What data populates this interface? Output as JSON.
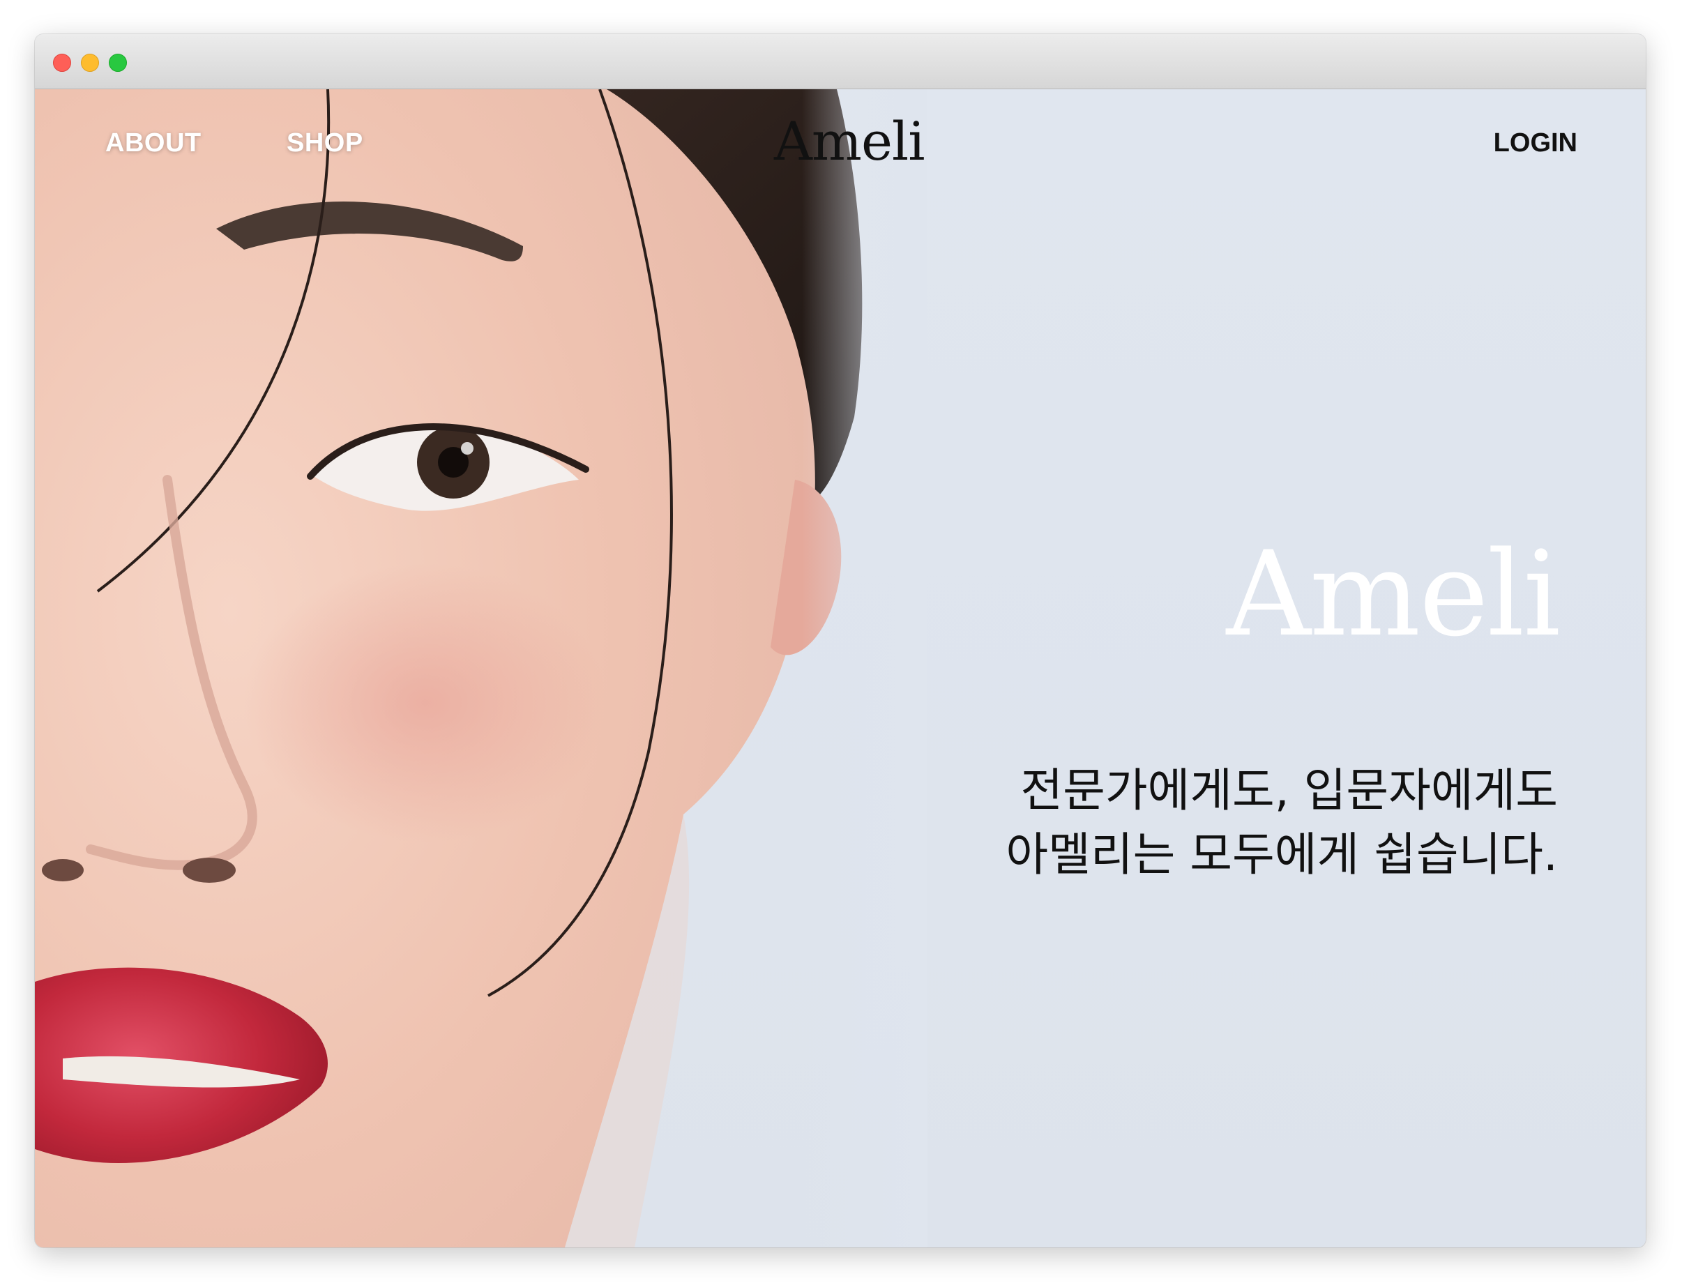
{
  "window": {
    "controls": [
      "close",
      "minimize",
      "zoom"
    ]
  },
  "nav": {
    "about_label": "ABOUT",
    "shop_label": "SHOP",
    "brand": "Ameli",
    "login_label": "LOGIN"
  },
  "hero": {
    "title": "Ameli",
    "tagline_line1": "전문가에게도, 입문자에게도",
    "tagline_line2": "아멜리는 모두에게 쉽습니다."
  },
  "colors": {
    "background": "#dfe5ee",
    "text_dark": "#111111",
    "text_light": "#ffffff",
    "lip": "#c2283c"
  }
}
